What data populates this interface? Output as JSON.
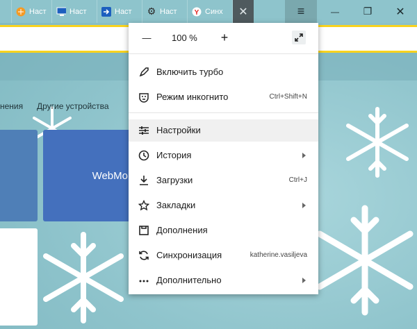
{
  "tabs": [
    {
      "label": "Наст",
      "icon": "orange-circle-icon"
    },
    {
      "label": "Наст",
      "icon": "monitor-icon"
    },
    {
      "label": "Наст",
      "icon": "arrow-right-icon"
    },
    {
      "label": "Наст",
      "icon": "gear-icon"
    },
    {
      "label": "Синх",
      "icon": "yandex-icon"
    }
  ],
  "tab_close_glyph": "✕",
  "window": {
    "menu_glyph": "≡",
    "minimize_glyph": "—",
    "restore_glyph": "❐",
    "close_glyph": "✕"
  },
  "page": {
    "links": [
      "нения",
      "Другие устройства"
    ],
    "tile_label": "WebMo"
  },
  "menu": {
    "zoom": {
      "minus": "—",
      "value": "100 %",
      "plus": "+"
    },
    "items": [
      {
        "label": "Включить турбо",
        "icon": "rocket-icon",
        "hint": "",
        "submenu": false,
        "highlighted": false
      },
      {
        "label": "Режим инкогнито",
        "icon": "incognito-icon",
        "hint": "Ctrl+Shift+N",
        "submenu": false,
        "highlighted": false
      },
      {
        "label": "Настройки",
        "icon": "settings-sliders-icon",
        "hint": "",
        "submenu": false,
        "highlighted": true
      },
      {
        "label": "История",
        "icon": "clock-icon",
        "hint": "",
        "submenu": true,
        "highlighted": false
      },
      {
        "label": "Загрузки",
        "icon": "download-icon",
        "hint": "Ctrl+J",
        "submenu": false,
        "highlighted": false
      },
      {
        "label": "Закладки",
        "icon": "star-icon",
        "hint": "",
        "submenu": true,
        "highlighted": false
      },
      {
        "label": "Дополнения",
        "icon": "extensions-icon",
        "hint": "",
        "submenu": false,
        "highlighted": false
      },
      {
        "label": "Синхронизация",
        "icon": "sync-icon",
        "hint": "katherine.vasiljeva",
        "submenu": false,
        "highlighted": false
      },
      {
        "label": "Дополнительно",
        "icon": "more-dots-icon",
        "hint": "",
        "submenu": true,
        "highlighted": false
      }
    ]
  }
}
